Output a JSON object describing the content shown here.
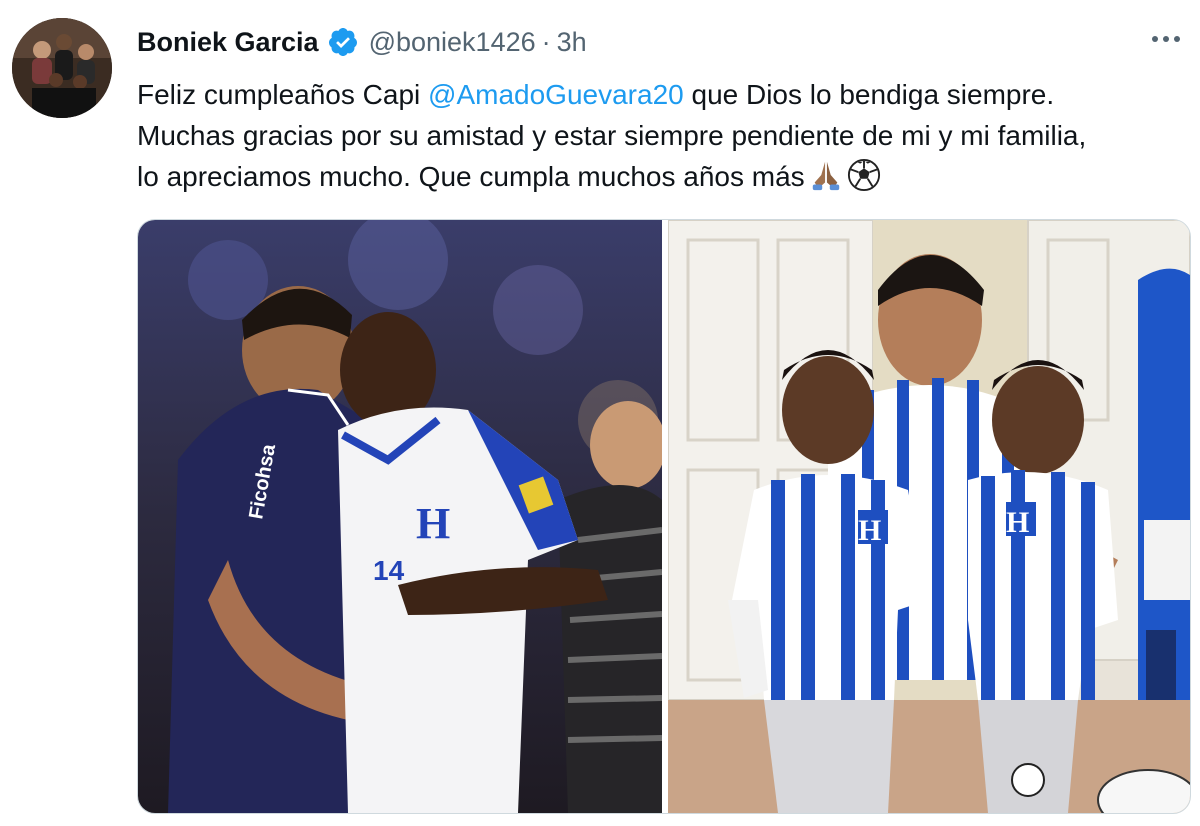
{
  "tweet": {
    "author_name": "Boniek Garcia",
    "author_handle": "@boniek1426",
    "separator": "·",
    "time": "3h",
    "text_line1_before": "Feliz cumpleaños Capi ",
    "mention": "@AmadoGuevara20",
    "text_line1_after": " que Dios lo bendiga siempre.",
    "text_line2": "Muchas gracias por su amistad y estar siempre pendiente de mi y mi familia,",
    "text_line3": "lo apreciamos mucho. Que cumpla muchos años más",
    "emojis": [
      "folded-hands-icon",
      "soccer-ball-icon"
    ]
  },
  "media": {
    "count": 2,
    "photo_left_subject": "two footballers in Honduras kit celebrating",
    "photo_right_subject": "man in Honduras jersey with two boys in Honduras kits"
  },
  "icons": [
    "verified-badge-icon",
    "more-options-icon"
  ],
  "colors": {
    "link": "#1d9bf0",
    "verified": "#1d9bf0",
    "secondary_text": "#536471",
    "primary_text": "#0f1419",
    "honduras_blue": "#1a4fd6"
  }
}
